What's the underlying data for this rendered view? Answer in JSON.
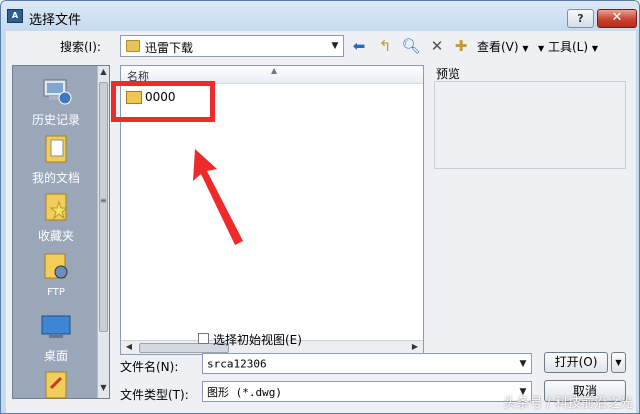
{
  "window": {
    "title": "选择文件",
    "help_label": "?",
    "close_label": "✕"
  },
  "toolbar": {
    "search_label": "搜索(I):",
    "location_value": "迅雷下载",
    "view_label": "查看(V)",
    "tools_label": "工具(L)"
  },
  "places": {
    "items": [
      {
        "label": "历史记录",
        "icon": "history-icon"
      },
      {
        "label": "我的文档",
        "icon": "documents-folder-icon"
      },
      {
        "label": "收藏夹",
        "icon": "favorites-folder-icon"
      },
      {
        "label": "FTP",
        "icon": "ftp-icon"
      },
      {
        "label": "桌面",
        "icon": "desktop-icon"
      }
    ]
  },
  "file_list": {
    "column_name": "名称",
    "items": [
      {
        "name": "0000",
        "icon": "folder-icon"
      }
    ]
  },
  "preview": {
    "label": "预览"
  },
  "options": {
    "initial_view_label": "选择初始视图(E)",
    "initial_view_checked": false
  },
  "fields": {
    "filename_label": "文件名(N):",
    "filename_value": "srca12306",
    "filetype_label": "文件类型(T):",
    "filetype_value": "图形 (*.dwg)"
  },
  "buttons": {
    "open_label": "打开(O)",
    "cancel_label": "取消"
  },
  "colors": {
    "annotation": "#ee2a2a"
  },
  "watermark": "头条号 / 科技前沿之光"
}
